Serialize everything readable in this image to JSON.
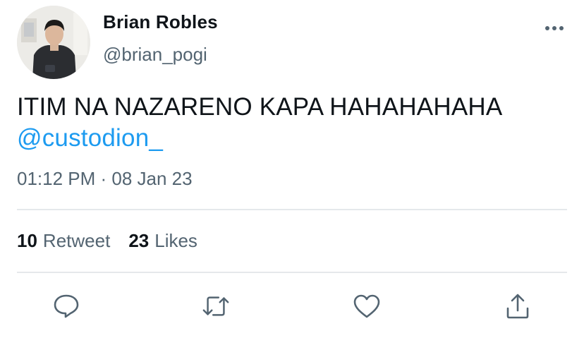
{
  "author": {
    "name": "Brian Robles",
    "handle": "@brian_pogi"
  },
  "tweet": {
    "text": "ITIM NA NAZARENO KAPA HAHAHAHAHA",
    "mention": "@custodion_",
    "timestamp": "01:12 PM · 08 Jan 23"
  },
  "stats": {
    "retweet_count": "10",
    "retweet_label": "Retweet",
    "likes_count": "23",
    "likes_label": "Likes"
  },
  "actions": [
    {
      "icon": "reply-icon"
    },
    {
      "icon": "retweet-icon"
    },
    {
      "icon": "like-icon"
    },
    {
      "icon": "share-icon"
    }
  ],
  "colors": {
    "text": "#0f1419",
    "secondary": "#536471",
    "link": "#1d9bf0",
    "divider": "#e5e8eb"
  }
}
